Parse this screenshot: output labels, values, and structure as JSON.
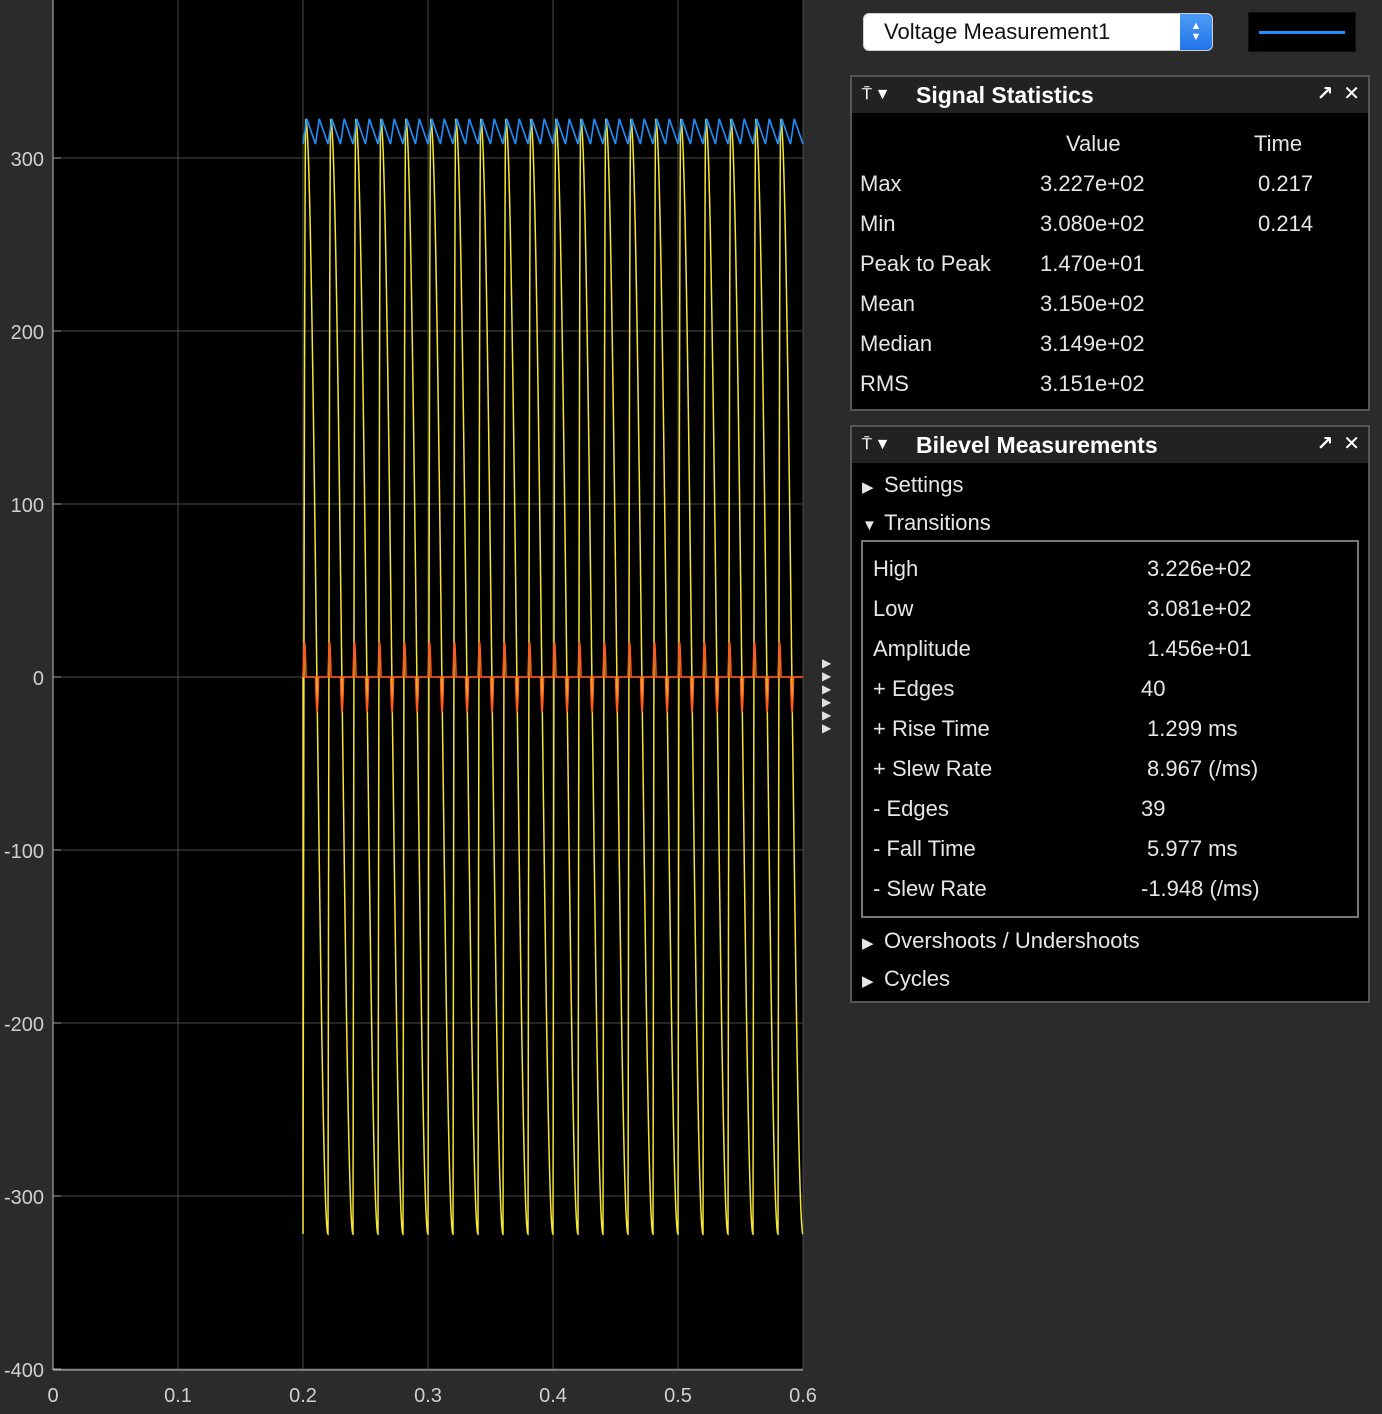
{
  "scope": {
    "y_ticks": [
      "300",
      "200",
      "100",
      "0",
      "-100",
      "-200",
      "-300",
      "-400"
    ],
    "x_ticks": [
      "0",
      "0.1",
      "0.2",
      "0.3",
      "0.4",
      "0.5",
      "0.6"
    ],
    "colors": {
      "background": "#000000",
      "phase_voltage": "#f5e632",
      "dc_voltage": "#1e90ff",
      "ripple": "#ff5a1e"
    }
  },
  "chart_data": {
    "type": "line",
    "xlim": [
      0,
      0.6
    ],
    "ylim": [
      -400,
      380
    ],
    "grid": true,
    "series": [
      {
        "color": "#f5e632",
        "start": 0.2,
        "end": 0.6,
        "cycles": 20,
        "amplitude": 322,
        "wave": "rectified-sine"
      },
      {
        "color": "#1e90ff",
        "start": 0.2,
        "end": 0.6,
        "min": 308.0,
        "max": 322.7,
        "ripple_cycles": 40
      },
      {
        "color": "#ff5a1e",
        "start": 0.2,
        "end": 0.6,
        "min": -20,
        "max": 20,
        "pulses": 40
      }
    ]
  },
  "signal_selector": {
    "value": "Voltage Measurement1",
    "line_color": "#1e90ff"
  },
  "signal_statistics": {
    "title": "Signal Statistics",
    "col_value": "Value",
    "col_time": "Time",
    "rows": [
      {
        "label": "Max",
        "value": "3.227e+02",
        "time": "0.217"
      },
      {
        "label": "Min",
        "value": "3.080e+02",
        "time": "0.214"
      },
      {
        "label": "Peak to Peak",
        "value": "1.470e+01",
        "time": ""
      },
      {
        "label": "Mean",
        "value": "3.150e+02",
        "time": ""
      },
      {
        "label": "Median",
        "value": "3.149e+02",
        "time": ""
      },
      {
        "label": "RMS",
        "value": "3.151e+02",
        "time": ""
      }
    ]
  },
  "bilevel": {
    "title": "Bilevel Measurements",
    "settings": "Settings",
    "transitions": "Transitions",
    "overshoots": "Overshoots / Undershoots",
    "cycles": "Cycles",
    "rows": [
      {
        "label": "High",
        "value": "3.226e+02"
      },
      {
        "label": "Low",
        "value": "3.081e+02"
      },
      {
        "label": "Amplitude",
        "value": "1.456e+01"
      },
      {
        "label": "+ Edges",
        "value": "40"
      },
      {
        "label": "+ Rise Time",
        "value": "1.299 ms"
      },
      {
        "label": "+ Slew Rate",
        "value": "8.967 (/ms)"
      },
      {
        "label": "- Edges",
        "value": "39"
      },
      {
        "label": "- Fall Time",
        "value": "5.977 ms"
      },
      {
        "label": "- Slew Rate",
        "value": "-1.948 (/ms)"
      }
    ]
  }
}
